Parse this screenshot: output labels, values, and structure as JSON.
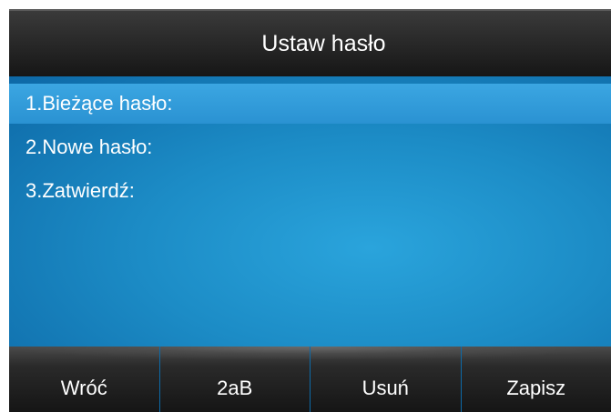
{
  "title": "Ustaw hasło",
  "fields": [
    {
      "label": "1.Bieżące hasło:"
    },
    {
      "label": "2.Nowe hasło:"
    },
    {
      "label": "3.Zatwierdź:"
    }
  ],
  "softkeys": [
    {
      "label": "Wróć"
    },
    {
      "label": "2aB"
    },
    {
      "label": "Usuń"
    },
    {
      "label": "Zapisz"
    }
  ],
  "colors": {
    "title_bar": "#1e1e1e",
    "content_bg": "#1c8cc6",
    "selected_row": "#3ba6e2",
    "softkey_bar": "#1a1a1a"
  }
}
